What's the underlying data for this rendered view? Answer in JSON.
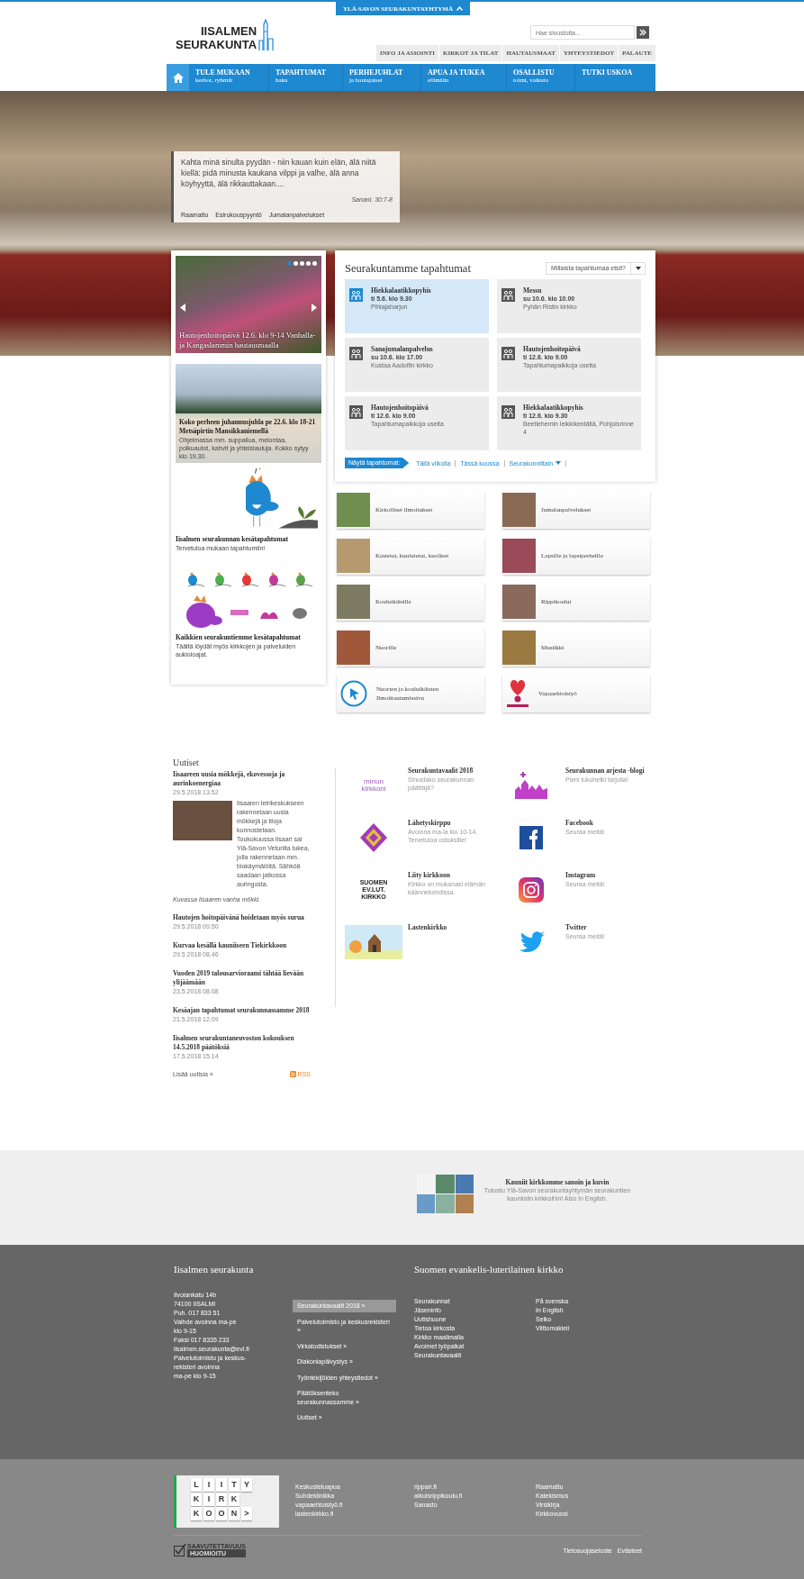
{
  "top_tab": {
    "label": "YLÄ-SAVON SEURAKUNTAYHTYMÄ"
  },
  "logo": {
    "lines": [
      "IISALMEN",
      "SEURAKUNTA"
    ]
  },
  "search": {
    "placeholder": "Hae sivustolta..."
  },
  "utility_nav": [
    "INFO JA ASIOINTI",
    "KIRKOT JA TILAT",
    "HAUTAUSMAAT",
    "YHTEYSTIEDOT",
    "PALAUTE"
  ],
  "main_nav": [
    {
      "title": "TULE MUKAAN",
      "subtitle": "kerhot, ryhmät"
    },
    {
      "title": "TAPAHTUMAT",
      "subtitle": "haku"
    },
    {
      "title": "PERHEJUHLAT",
      "subtitle": "ja hautajaiset"
    },
    {
      "title": "APUA JA TUKEA",
      "subtitle": "elämään"
    },
    {
      "title": "OSALLISTU",
      "subtitle": "toimi, vaikuta"
    },
    {
      "title": "TUTKI USKOA"
    }
  ],
  "hero": {
    "quote": "Kahta minä sinulta pyydän - niin kauan kuin elän, älä niitä kiellä: pidä minusta kaukana vilppi ja valhe, älä anna köyhyyttä, älä rikkauttakaan....",
    "reference": "Sananl. 30:7-8",
    "links": [
      "Raamattu",
      "Esirukouspyyntö",
      "Jumalanpalvelukset"
    ]
  },
  "carousel": {
    "caption": "Hautojenhoitopäivä 12.6. klo 9-14 Vanhalla- ja Kangaslammin hautausmaalla",
    "dots": [
      {
        "selected": true
      },
      {
        "selected": false
      },
      {
        "selected": false
      },
      {
        "selected": false
      },
      {
        "selected": false
      }
    ]
  },
  "promos": [
    {
      "kind": "photo",
      "title": "Koko perheen juhannusjuhla pe 22.6. klo 18-21 Metsäpirtin Mansikkaniemellä",
      "text": "Ohjelmassa mm. suppailua, melontaa, polkuautot, kahvit ja yhteislauluja. Kokko sytyy klo 19.30."
    },
    {
      "kind": "bird",
      "title": "Iisalmen seurakunnan kesätapahtumat",
      "text": "Tervetuloa mukaan tapahtumiin!"
    },
    {
      "kind": "birds",
      "title": "Kaikkien seurakuntiemme kesätapahtumat",
      "text": "Täältä löydät myös kirkkojen ja palveluiden aukioloajat."
    }
  ],
  "events": {
    "title": "Seurakuntamme tapahtumat",
    "filter_placeholder": "Millaista tapahtumaa etsit?",
    "items": [
      {
        "title": "Hiekkalaatikkopyhis",
        "date": "ti 5.6. klo 9.30",
        "place": "Pihlajaharjun",
        "selected": true
      },
      {
        "title": "Messu",
        "date": "su 10.6. klo 10.00",
        "place": "Pyhän Ristin kirkko",
        "selected": false
      },
      {
        "title": "Sanajumalanpalvelus",
        "date": "su 10.6. klo 17.00",
        "place": "Kustaa Aadolfin kirkko",
        "selected": false
      },
      {
        "title": "Hautojenhoitopäivä",
        "date": "ti 12.6. klo 9.00",
        "place": "Tapahtumapaikkoja useita",
        "selected": false
      },
      {
        "title": "Hautojenhoitopäivä",
        "date": "ti 12.6. klo 9.00",
        "place": "Tapahtumapaikkoja useita",
        "selected": false
      },
      {
        "title": "Hiekkalaatikkopyhis",
        "date": "ti 12.6. klo 9.30",
        "place": "Beetlehemin leikkikentällä, Pohjoisrinne 4",
        "selected": false
      }
    ],
    "show_label": "Näytä tapahtumat:",
    "filters": [
      "Tällä viikolla",
      "Tässä kuussa",
      "Seurakunnittain"
    ]
  },
  "tiles": [
    {
      "kind": "photo",
      "label": "Kirkolliset ilmoitukset"
    },
    {
      "kind": "photo",
      "label": "Jumalanpalvelukset"
    },
    {
      "kind": "photo",
      "label": "Kastetut, kuulutetut, kuolleet"
    },
    {
      "kind": "photo",
      "label": "Lapsille ja lapsiperheille"
    },
    {
      "kind": "photo",
      "label": "Kouluikäisille"
    },
    {
      "kind": "photo",
      "label": "Rippikoulut"
    },
    {
      "kind": "photo",
      "label": "Nuorille"
    },
    {
      "kind": "photo",
      "label": "Musiikki"
    },
    {
      "kind": "pointer",
      "label": "Nuorten ja kouluikäisten Ilmoittautumissivu"
    },
    {
      "kind": "heart",
      "label": "Vapaaehtoistyö"
    }
  ],
  "news": {
    "title": "Uutiset",
    "featured": {
      "title": "Iisaareen uusia mökkejä, ekovessoja ja aurinkoenergiaa",
      "date": "29.5.2018 13.52",
      "text": "Iisaaren leirikeskukseen rakennetaan uusia mökkejä ja tiloja kunnostetaan. Toukokuussa Iisaari sai Ylä-Savon Veturilta tukea, jolla rakennetaan mm. biokäymälöitä. Sähköä saadaan jatkossa auringosta.",
      "caption": "Kuvassa Iisaaren vanha mökki."
    },
    "items": [
      {
        "title": "Hautojen hoitopäivänä hoidetaan myös surua",
        "date": "29.5.2018 09.50"
      },
      {
        "title": "Kurvaa kesällä kauniiseen Tiekirkkoon",
        "date": "29.5.2018 08.46"
      },
      {
        "title": "Vuoden 2019 talousarvioraami tähtää lievään ylijäämään",
        "date": "23.5.2018 08.08"
      },
      {
        "title": "Kesäajan tapahtumat seurakunnassamme 2018",
        "date": "21.5.2018 12.09"
      },
      {
        "title": "Iisalmen seurakuntaneuvoston kokouksen 14.5.2018 päätöksiä",
        "date": "17.5.2018 15.14"
      }
    ],
    "more": "Lisää uutisia »",
    "rss": "RSS"
  },
  "links": [
    [
      {
        "kind": "minun-kirkkoni",
        "logo_lines": [
          "minun",
          "kirkkoni"
        ],
        "title": "Seurakuntavaalit 2018",
        "text": "Sinustako seurakunnan päättäjä?"
      },
      {
        "kind": "pattern",
        "title": "Lähetyskirppu",
        "text": "Avoinna ma-la klo 10-14. Tervetuloa ostoksille!"
      },
      {
        "kind": "evl",
        "logo_lines": [
          "SUOMEN",
          "EV.LUT.",
          "KIRKKO"
        ],
        "title": "Liity kirkkoon",
        "text": "Kirkko on mukanasi elämän käännekohdissa."
      },
      {
        "kind": "picture",
        "title": "Lastenkirkko"
      }
    ],
    [
      {
        "kind": "blog",
        "title": "Seurakunnan arjesta -blogi",
        "text": "Pieni lukuhetki tarjolla!"
      },
      {
        "kind": "facebook",
        "title": "Facebook",
        "text": "Seuraa meitä!"
      },
      {
        "kind": "instagram",
        "title": "Instagram",
        "text": "Seuraa meitä!"
      },
      {
        "kind": "twitter",
        "title": "Twitter",
        "text": "Seuraa meitä!"
      }
    ]
  ],
  "banner": {
    "title": "Kauniit kirkkomme sanoin ja kuvin",
    "text": "Tutustu Ylä-Savon seurakuntayhtymän seurakuntien kauniisiin kirkkoihin! Also in English."
  },
  "footer": {
    "parish": {
      "title": "Iisalmen seurakunta",
      "lines": [
        "Ilvolankatu 14b",
        "74100 IISALMI",
        "Puh. 017 833 51",
        "Vaihde avoinna ma-pe",
        "klo 9-15",
        "Faksi 017 8335 233",
        "iisalmen.seurakunta@evl.fi",
        "Palvelutoimisto ja keskus-",
        "rekisteri avoinna",
        "ma-pe klo 9-15"
      ]
    },
    "menu": [
      {
        "label": "Seurakuntavaalit 2018 »",
        "selected": true
      },
      {
        "label": "Palvelutoimisto ja keskusrekisteri »",
        "selected": false
      },
      {
        "label": "Virkatodistukset »",
        "selected": false
      },
      {
        "label": "Diakoniapäivystys »",
        "selected": false
      },
      {
        "label": "Työntekijöiden yhteystiedot »",
        "selected": false
      },
      {
        "label": "Päätöksenteko seurakunnassamme »",
        "selected": false
      },
      {
        "label": "Uutiset »",
        "selected": false
      }
    ],
    "church": {
      "title": "Suomen evankelis-luterilainen kirkko",
      "columns": [
        [
          "Seurakunnat",
          "Jäseninfo",
          "Uutishuone",
          "Tietoa kirkosta",
          "Kirkko maailmalla",
          "Avoimet työpaikat",
          "Seurakuntavaalit"
        ],
        [
          "På svenska",
          "In English",
          "Selko",
          "Viittomakieli"
        ]
      ]
    }
  },
  "bottom": {
    "tiles": [
      [
        "L",
        "I",
        "I",
        "T",
        "Y"
      ],
      [
        "K",
        "I",
        "R",
        "K"
      ],
      [
        "K",
        "O",
        "O",
        "N",
        ">"
      ]
    ],
    "columns": [
      [
        "Keskusteluapua",
        "Suhdeklinikka",
        "vapaaehtoistyö.fi",
        "lastenkirkko.fi"
      ],
      [
        "rippari.fi",
        "aikuisrippikoulu.fi",
        "Sanasto"
      ],
      [
        "Raamattu",
        "Katekismus",
        "Virsikirja",
        "Kirkkovuosi"
      ]
    ],
    "badge": [
      "SAAVUTETTAVUUS",
      "HUOMIOITU"
    ],
    "links": [
      "Tietosuojaseloste",
      "Evästeet"
    ]
  }
}
